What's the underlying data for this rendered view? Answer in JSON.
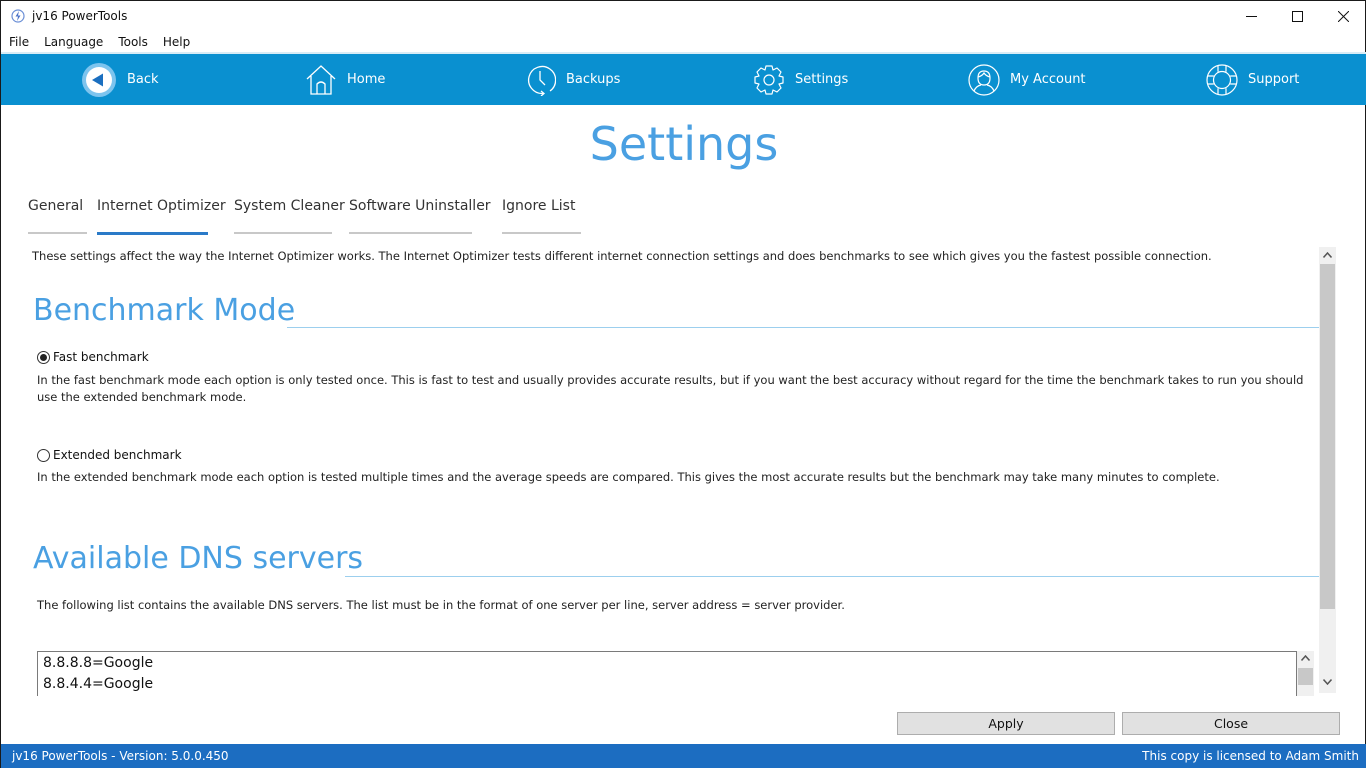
{
  "window": {
    "title": "jv16 PowerTools",
    "controls": [
      "minimize",
      "maximize",
      "close"
    ]
  },
  "menubar": {
    "items": [
      "File",
      "Language",
      "Tools",
      "Help"
    ]
  },
  "nav": {
    "items": [
      {
        "label": "Back",
        "icon": "back-arrow-icon"
      },
      {
        "label": "Home",
        "icon": "home-icon"
      },
      {
        "label": "Backups",
        "icon": "clock-icon"
      },
      {
        "label": "Settings",
        "icon": "gear-icon"
      },
      {
        "label": "My Account",
        "icon": "user-icon"
      },
      {
        "label": "Support",
        "icon": "lifebuoy-icon"
      }
    ]
  },
  "page": {
    "title": "Settings"
  },
  "tabs": {
    "items": [
      "General",
      "Internet Optimizer",
      "System Cleaner",
      "Software Uninstaller",
      "Ignore List"
    ],
    "active": "Internet Optimizer"
  },
  "content": {
    "intro": "These settings affect the way the Internet Optimizer works. The Internet Optimizer tests different internet connection settings and does benchmarks to see which gives you the fastest possible connection.",
    "benchmark": {
      "heading": "Benchmark Mode",
      "options": [
        {
          "label": "Fast benchmark",
          "checked": true,
          "description": "In the fast benchmark mode each option is only tested once. This is fast to test and usually provides accurate results, but if you want the best accuracy without regard for the time the benchmark takes to run you should use the extended benchmark mode."
        },
        {
          "label": "Extended benchmark",
          "checked": false,
          "description": "In the extended benchmark mode each option is tested multiple times and the average speeds are compared. This gives the most accurate results but the benchmark may take many minutes to complete."
        }
      ]
    },
    "dns": {
      "heading": "Available DNS servers",
      "description": "The following list contains the available DNS servers. The list must be in the format of one server per line, server address = server provider.",
      "servers": [
        "8.8.8.8=Google",
        "8.8.4.4=Google"
      ]
    }
  },
  "buttons": {
    "apply": "Apply",
    "close": "Close"
  },
  "status": {
    "version": "jv16 PowerTools - Version: 5.0.0.450",
    "license": "This copy is licensed to Adam Smith"
  },
  "colors": {
    "nav_bg": "#0a90d0",
    "heading_blue": "#4aa0e2",
    "status_bg": "#1c6dc1",
    "active_tab": "#2a7ac8"
  }
}
